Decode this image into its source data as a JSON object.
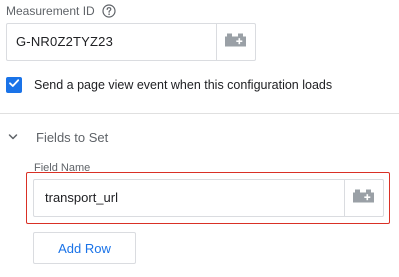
{
  "measurement": {
    "label": "Measurement ID",
    "value": "G-NR0Z2TYZ23"
  },
  "pageview": {
    "checked": true,
    "label": "Send a page view event when this configuration loads"
  },
  "fields_section": {
    "title": "Fields to Set",
    "column_label": "Field Name",
    "rows": [
      {
        "field_name": "transport_url"
      }
    ],
    "add_row_label": "Add Row"
  },
  "colors": {
    "accent": "#1a73e8",
    "highlight_border": "#d93025",
    "border": "#dadce0",
    "muted_text": "#5f6368",
    "icon_gray": "#9aa0a6"
  },
  "icons": {
    "help": "help-circle-icon",
    "variable": "variable-brick-icon",
    "checkbox": "checkmark-icon",
    "section_toggle": "chevron-down-icon"
  }
}
